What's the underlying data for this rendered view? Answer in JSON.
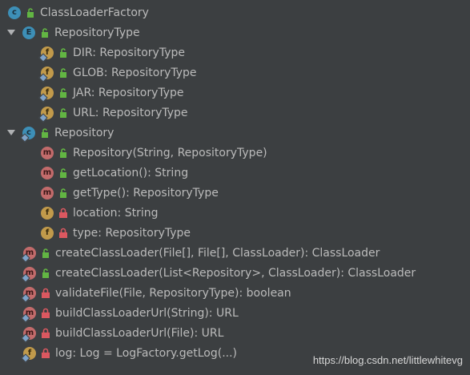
{
  "tree": {
    "root": {
      "label": "ClassLoaderFactory",
      "kind": "class",
      "visibility": "public",
      "icon": "class-icon"
    },
    "repository_type": {
      "label": "RepositoryType",
      "kind": "enum",
      "visibility": "public",
      "expanded": true,
      "children": [
        {
          "label": "DIR: RepositoryType",
          "kind": "field",
          "visibility": "public"
        },
        {
          "label": "GLOB: RepositoryType",
          "kind": "field",
          "visibility": "public"
        },
        {
          "label": "JAR: RepositoryType",
          "kind": "field",
          "visibility": "public"
        },
        {
          "label": "URL: RepositoryType",
          "kind": "field",
          "visibility": "public"
        }
      ]
    },
    "repository": {
      "label": "Repository",
      "kind": "class",
      "visibility": "public",
      "expanded": true,
      "children": [
        {
          "label": "Repository(String, RepositoryType)",
          "kind": "method",
          "visibility": "public"
        },
        {
          "label": "getLocation(): String",
          "kind": "method",
          "visibility": "public"
        },
        {
          "label": "getType(): RepositoryType",
          "kind": "method",
          "visibility": "public"
        },
        {
          "label": "location: String",
          "kind": "field",
          "visibility": "private"
        },
        {
          "label": "type: RepositoryType",
          "kind": "field",
          "visibility": "private"
        }
      ]
    },
    "members": [
      {
        "label": "createClassLoader(File[], File[], ClassLoader): ClassLoader",
        "kind": "method",
        "visibility": "public"
      },
      {
        "label": "createClassLoader(List<Repository>, ClassLoader): ClassLoader",
        "kind": "method",
        "visibility": "public"
      },
      {
        "label": "validateFile(File, RepositoryType): boolean",
        "kind": "method",
        "visibility": "private"
      },
      {
        "label": "buildClassLoaderUrl(String): URL",
        "kind": "method",
        "visibility": "private"
      },
      {
        "label": "buildClassLoaderUrl(File): URL",
        "kind": "method",
        "visibility": "private"
      },
      {
        "label": "log: Log = LogFactory.getLog(...)",
        "kind": "field",
        "visibility": "private"
      }
    ]
  },
  "badges": {
    "class": "c",
    "enum": "E",
    "field": "f",
    "method": "m"
  },
  "watermark": "https://blog.csdn.net/littlewhitevg",
  "colors": {
    "background": "#3c3f41",
    "text": "#bbbbbb",
    "class_badge": "#3d8fb7",
    "field_badge": "#c19a4b",
    "method_badge": "#c26b6b",
    "public_lock": "#62b543",
    "private_lock": "#db5860"
  }
}
